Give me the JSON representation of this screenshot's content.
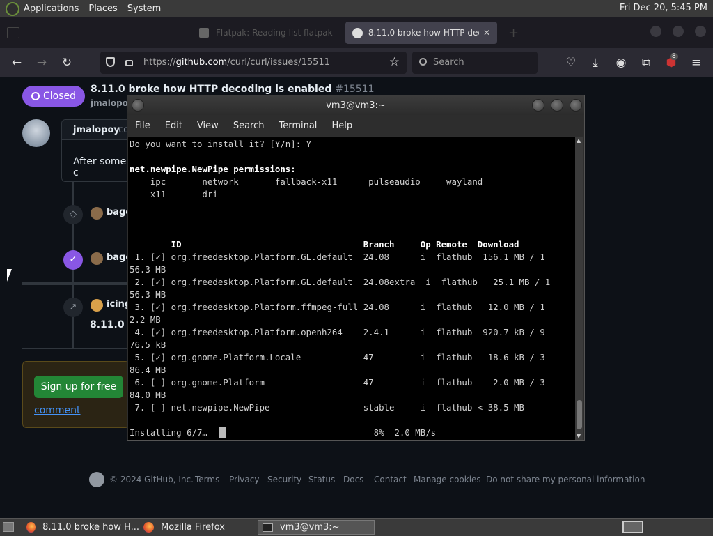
{
  "top_panel": {
    "menus": [
      "Applications",
      "Places",
      "System"
    ],
    "clock": "Fri Dec 20,  5:45 PM"
  },
  "browser": {
    "tabs": [
      {
        "label": "Flatpak: Reading list flatpak"
      },
      {
        "label": "8.11.0 broke how HTTP deco"
      }
    ],
    "url_https": "https://",
    "url_domain": "github.com",
    "url_path": "/curl/curl/issues/15511",
    "search_placeholder": "Search",
    "notification_badge": "8"
  },
  "issue": {
    "status": "Closed",
    "title": "8.11.0 broke how HTTP decoding is enabled",
    "number": "#15511",
    "author_line": "jmalopoy",
    "comment_author": "jmalopoy",
    "comment_suffix": "co",
    "comment_body": "After some c",
    "events": [
      {
        "user": "bago"
      },
      {
        "user": "bago"
      },
      {
        "user": "icing"
      }
    ],
    "ref_title": "8.11.0 s",
    "signup_label": "Sign up for free",
    "comment_link": "comment"
  },
  "footer": {
    "copyright": "© 2024 GitHub, Inc.",
    "links": [
      "Terms",
      "Privacy",
      "Security",
      "Status",
      "Docs",
      "Contact",
      "Manage cookies",
      "Do not share my personal information"
    ]
  },
  "terminal": {
    "title": "vm3@vm3:~",
    "menus": [
      "File",
      "Edit",
      "View",
      "Search",
      "Terminal",
      "Help"
    ],
    "lines": [
      "Do you want to install it? [Y/n]: Y",
      "",
      "net.newpipe.NewPipe permissions:",
      "    ipc       network       fallback-x11      pulseaudio     wayland",
      "    x11       dri",
      "",
      "",
      "",
      "        ID                                   Branch     Op Remote  Download",
      " 1. [✓] org.freedesktop.Platform.GL.default  24.08      i  flathub  156.1 MB / 1",
      "56.3 MB",
      " 2. [✓] org.freedesktop.Platform.GL.default  24.08extra  i  flathub   25.1 MB / 1",
      "56.3 MB",
      " 3. [✓] org.freedesktop.Platform.ffmpeg-full 24.08      i  flathub   12.0 MB / 1",
      "2.2 MB",
      " 4. [✓] org.freedesktop.Platform.openh264    2.4.1      i  flathub  920.7 kB / 9",
      "76.5 kB",
      " 5. [✓] org.gnome.Platform.Locale            47         i  flathub   18.6 kB / 3",
      "86.4 MB",
      " 6. [—] org.gnome.Platform                   47         i  flathub    2.0 MB / 3",
      "84.0 MB",
      " 7. [ ] net.newpipe.NewPipe                  stable     i  flathub < 38.5 MB",
      "",
      "Installing 6/7…                                8%  2.0 MB/s"
    ]
  },
  "taskbar": {
    "tasks": [
      {
        "label": "8.11.0 broke how H..."
      },
      {
        "label": "Mozilla Firefox"
      },
      {
        "label": "vm3@vm3:~"
      }
    ]
  }
}
